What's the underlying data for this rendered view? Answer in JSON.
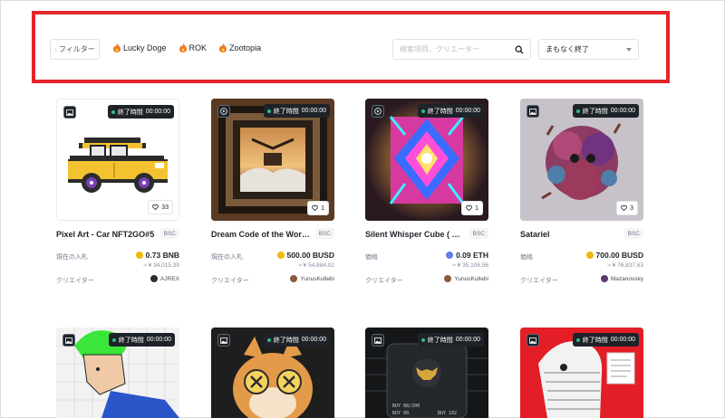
{
  "filter_bar": {
    "filter_label": "フィルター",
    "tags": [
      "Lucky Doge",
      "ROK",
      "Zootopia"
    ],
    "search_placeholder": "検索項目、クリエーター",
    "sort_value": "まもなく終了"
  },
  "cards": [
    {
      "timer_label": "終了時間",
      "timer_value": "00:00:00",
      "likes": "33",
      "name": "Pixel Art - Car NFT2GO#5",
      "chain": "BSC",
      "price_label": "現在の入札",
      "price": "0.73 BNB",
      "fiat": "≈ ¥ 34,015.39",
      "creator_label": "クリエイター",
      "creator": "AJREX",
      "coin_color": "#f0b90b",
      "avatar_color": "#2b2f36",
      "media": "image"
    },
    {
      "timer_label": "終了時間",
      "timer_value": "00:00:00",
      "likes": "1",
      "name": "Dream Code of the World ...",
      "chain": "BSC",
      "price_label": "現在の入札",
      "price": "500.00 BUSD",
      "fiat": "≈ ¥ 54,884.02",
      "creator_label": "クリエイター",
      "creator": "YunusKullebi",
      "coin_color": "#f0b90b",
      "avatar_color": "#8a5a3c",
      "media": "video"
    },
    {
      "timer_label": "終了時間",
      "timer_value": "00:00:00",
      "likes": "1",
      "name": "Silent Whisper Cube ( Pie...",
      "chain": "BSC",
      "price_label": "価格",
      "price": "0.09 ETH",
      "fiat": "≈ ¥ 35,106.56",
      "creator_label": "クリエイター",
      "creator": "YunusKullebi",
      "coin_color": "#627eea",
      "avatar_color": "#8a5a3c",
      "media": "video"
    },
    {
      "timer_label": "終了時間",
      "timer_value": "00:00:00",
      "likes": "3",
      "name": "Satariel",
      "chain": "BSC",
      "price_label": "価格",
      "price": "700.00 BUSD",
      "fiat": "≈ ¥ 76,837.63",
      "creator_label": "クリエイター",
      "creator": "Mazanovsky",
      "coin_color": "#f0b90b",
      "avatar_color": "#5b3b6e",
      "media": "image"
    },
    {
      "timer_label": "終了時間",
      "timer_value": "00:00:00",
      "media": "image"
    },
    {
      "timer_label": "終了時間",
      "timer_value": "00:00:00",
      "media": "image"
    },
    {
      "timer_label": "終了時間",
      "timer_value": "00:00:00",
      "media": "image",
      "art_text": [
        "BUY 88/200",
        "BUY 90",
        "BUY 102"
      ]
    },
    {
      "timer_label": "終了時間",
      "timer_value": "00:00:00",
      "media": "image"
    }
  ]
}
